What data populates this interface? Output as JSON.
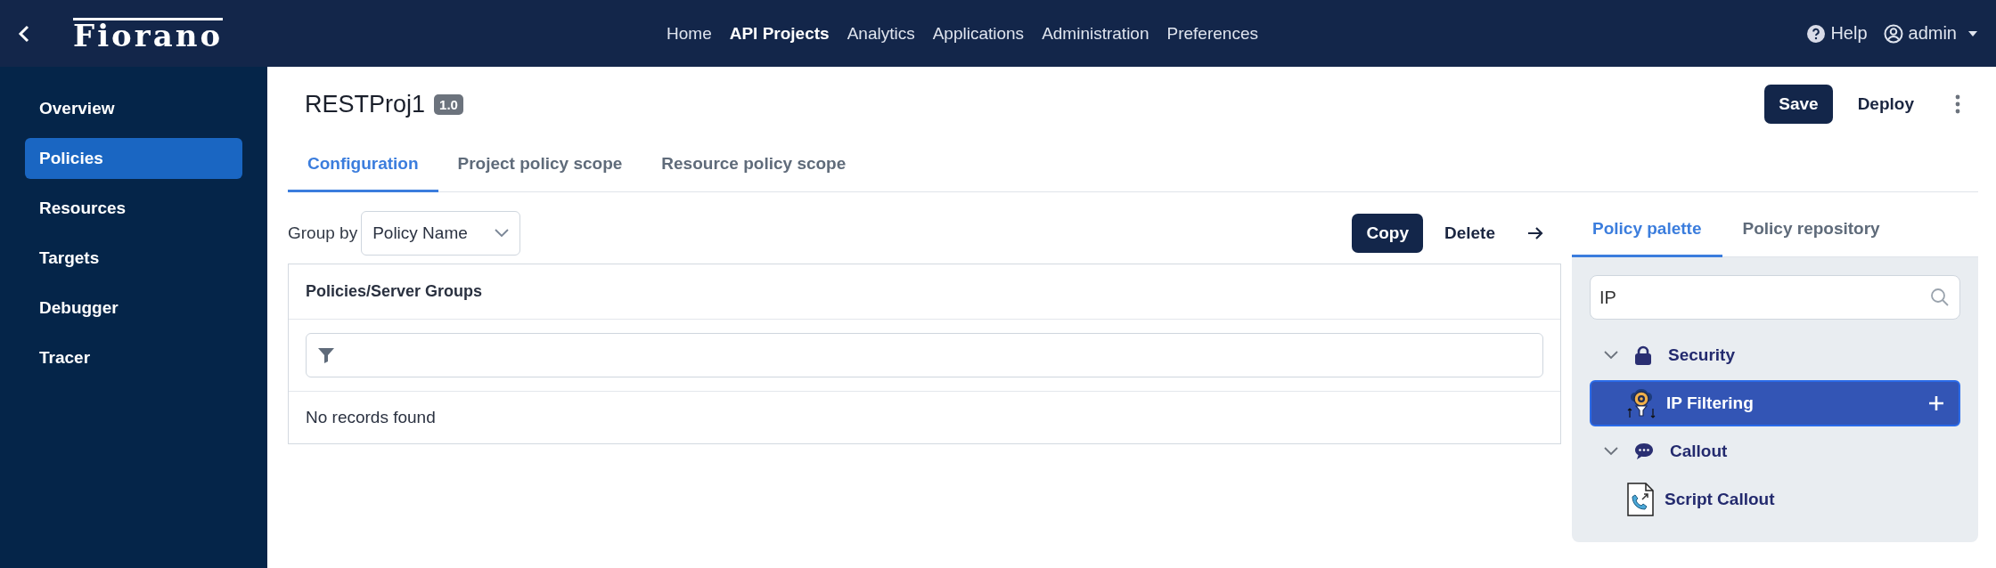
{
  "top_bar": {
    "logo": "Fiorano",
    "nav": [
      {
        "label": "Home",
        "selected": false
      },
      {
        "label": "API Projects",
        "selected": true
      },
      {
        "label": "Analytics",
        "selected": false
      },
      {
        "label": "Applications",
        "selected": false
      },
      {
        "label": "Administration",
        "selected": false
      },
      {
        "label": "Preferences",
        "selected": false
      }
    ],
    "help": "Help",
    "user": "admin"
  },
  "sidebar": {
    "items": [
      {
        "label": "Overview",
        "selected": false
      },
      {
        "label": "Policies",
        "selected": true
      },
      {
        "label": "Resources",
        "selected": false
      },
      {
        "label": "Targets",
        "selected": false
      },
      {
        "label": "Debugger",
        "selected": false
      },
      {
        "label": "Tracer",
        "selected": false
      }
    ]
  },
  "project": {
    "title": "RESTProj1",
    "version": "1.0"
  },
  "actions": [
    {
      "label": "Save",
      "kind": "primary"
    },
    {
      "label": "Deploy",
      "kind": "text"
    }
  ],
  "tabs": [
    {
      "label": "Configuration",
      "selected": true
    },
    {
      "label": "Project policy scope",
      "selected": false
    },
    {
      "label": "Resource policy scope",
      "selected": false
    }
  ],
  "group_by": {
    "label": "Group by",
    "value": "Policy Name"
  },
  "table_actions": [
    {
      "label": "Copy",
      "kind": "primary"
    },
    {
      "label": "Delete",
      "kind": "text"
    }
  ],
  "table": {
    "columns": [
      "Policies/Server Groups"
    ],
    "empty_message": "No records found"
  },
  "palette": {
    "tabs": [
      {
        "label": "Policy palette",
        "selected": true
      },
      {
        "label": "Policy repository",
        "selected": false
      }
    ],
    "search": {
      "value": "IP"
    },
    "tree": [
      {
        "label": "Security",
        "expanded": true,
        "children": [
          {
            "label": "IP Filtering",
            "selected": true
          }
        ]
      },
      {
        "label": "Callout",
        "expanded": true,
        "children": [
          {
            "label": "Script Callout",
            "selected": false
          }
        ]
      }
    ]
  }
}
